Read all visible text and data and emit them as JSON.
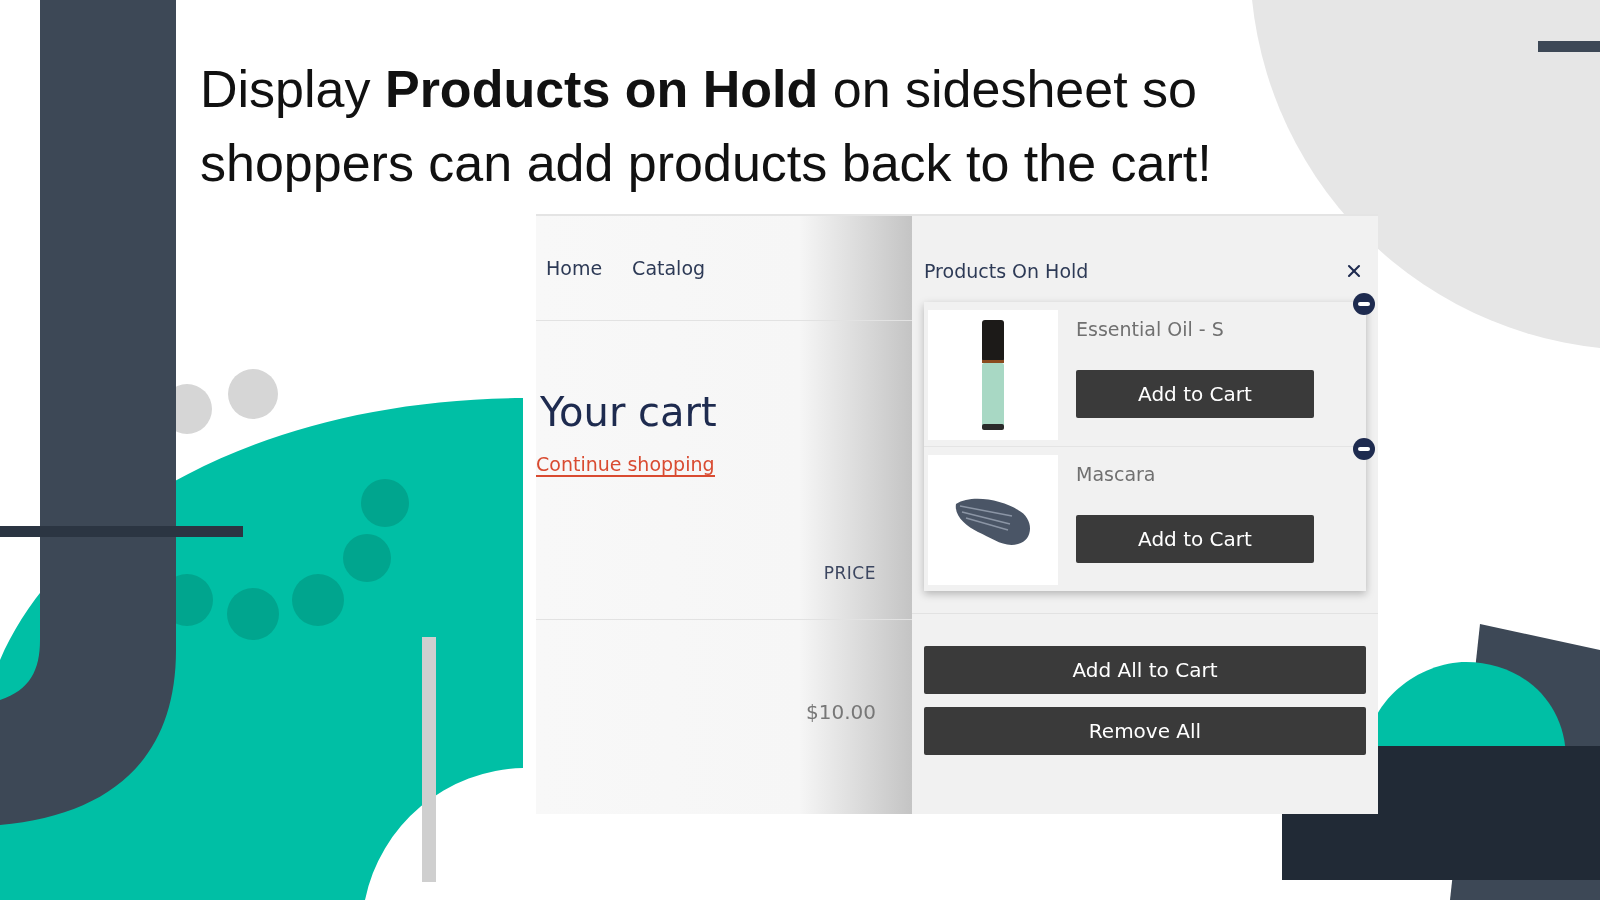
{
  "headline": "Display **Products on Hold** on sidesheet so shoppers can add products back to the cart!",
  "store": {
    "nav": [
      {
        "label": "Home"
      },
      {
        "label": "Catalog"
      }
    ],
    "title": "Your cart",
    "continue_link": "Continue shopping",
    "price_header": "PRICE",
    "price": "$10.00"
  },
  "sidesheet": {
    "title": "Products On Hold",
    "items": [
      {
        "name": "Essential Oil - S",
        "kind": "bottle",
        "button": "Add to Cart"
      },
      {
        "name": "Mascara",
        "kind": "smudge",
        "button": "Add to Cart"
      }
    ],
    "actions": [
      "Add All to Cart",
      "Remove All"
    ]
  }
}
